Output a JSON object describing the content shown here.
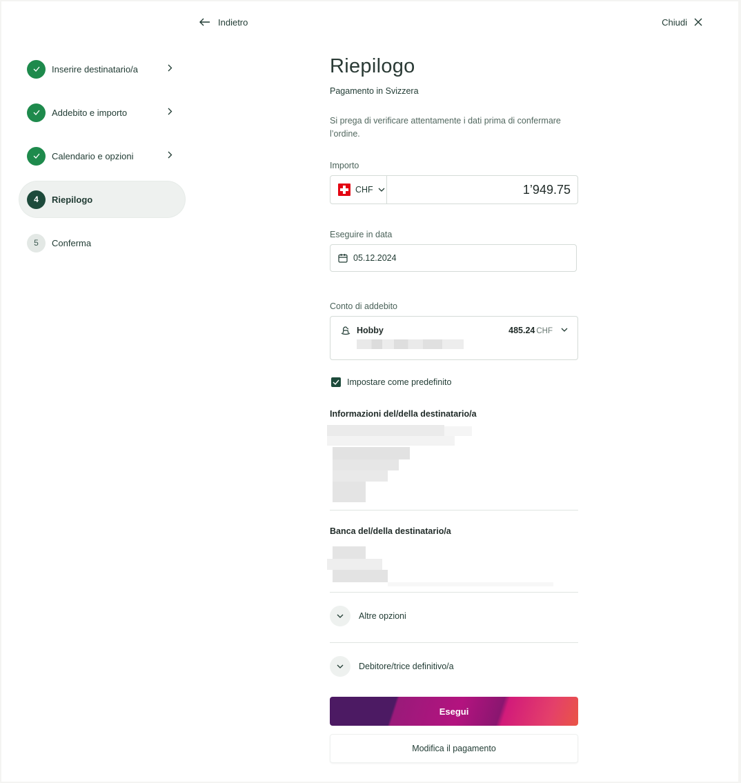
{
  "topbar": {
    "back_label": "Indietro",
    "close_label": "Chiudi"
  },
  "stepper": {
    "steps": [
      {
        "label": "Inserire destinatario/a",
        "status": "done"
      },
      {
        "label": "Addebito e importo",
        "status": "done"
      },
      {
        "label": "Calendario e opzioni",
        "status": "done"
      },
      {
        "number": "4",
        "label": "Riepilogo",
        "status": "current"
      },
      {
        "number": "5",
        "label": "Conferma",
        "status": "todo"
      }
    ]
  },
  "main": {
    "title": "Riepilogo",
    "subtitle": "Pagamento in Svizzera",
    "note": "Si prega di verificare attentamente i dati prima di confermare l’ordine.",
    "amount": {
      "label": "Importo",
      "currency": "CHF",
      "value": "1’949.75"
    },
    "date": {
      "label": "Eseguire in data",
      "value": "05.12.2024"
    },
    "account": {
      "label": "Conto di addebito",
      "name": "Hobby",
      "balance": "485.24",
      "currency": "CHF"
    },
    "default_checkbox": {
      "label": "Impostare come predefinito",
      "checked": true
    },
    "recipient_info_title": "Informazioni del/della destinatario/a",
    "recipient_bank_title": "Banca del/della destinatario/a",
    "other_options_label": "Altre opzioni",
    "final_debtor_label": "Debitore/trice definitivo/a",
    "execute_button": "Esegui",
    "modify_button": "Modifica il pagamento"
  },
  "colors": {
    "accent_green": "#1e8a4c",
    "dark_green": "#1d4a3b",
    "button_purple": "#4c1a63",
    "button_red": "#ea5545"
  }
}
